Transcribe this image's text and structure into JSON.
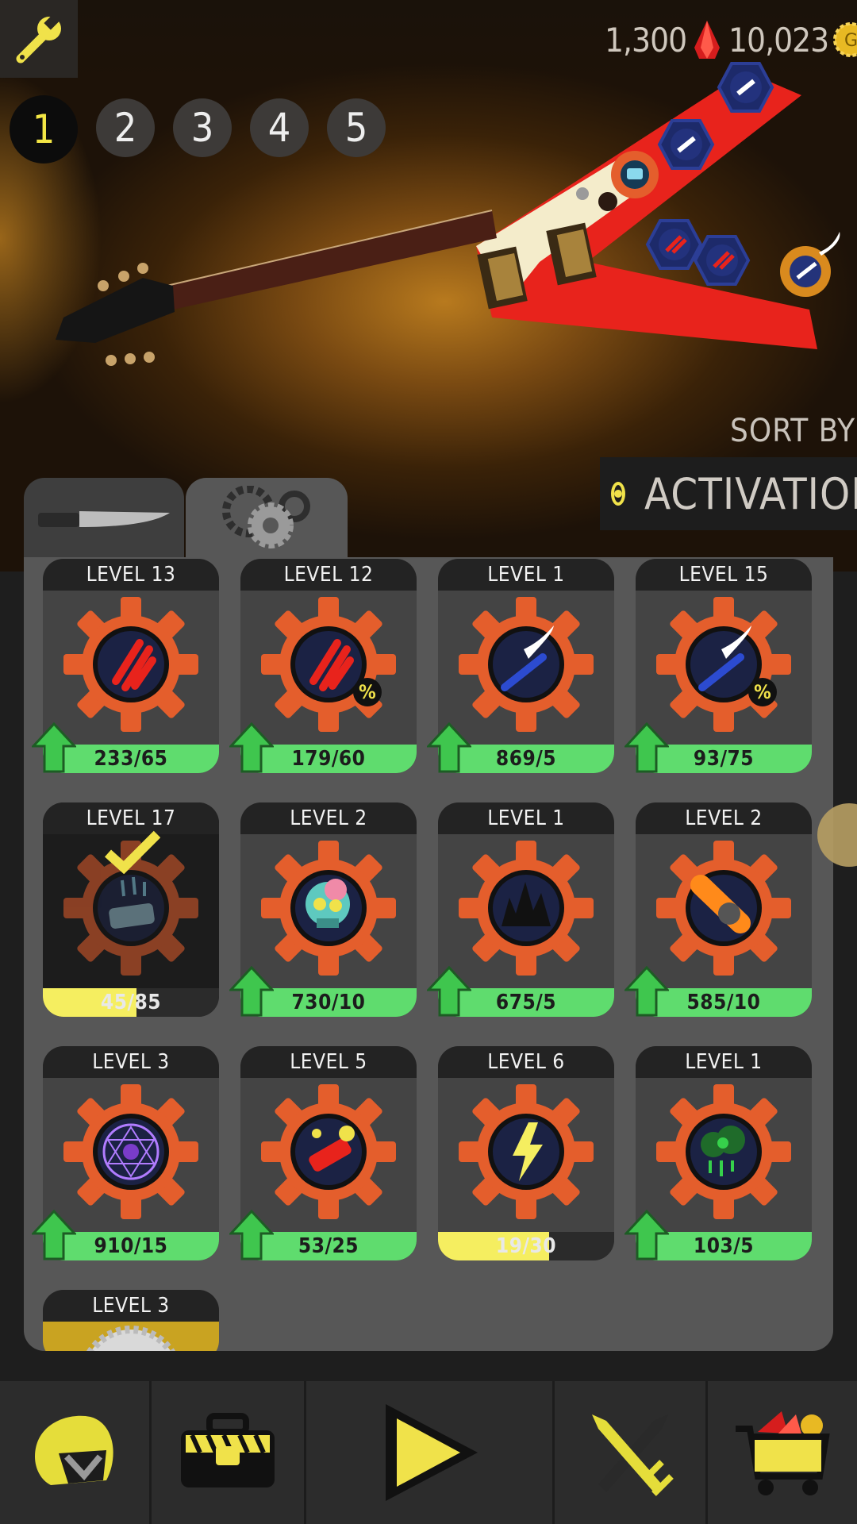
{
  "currency": {
    "gems": "1,300",
    "gold": "10,023",
    "gold_symbol": "G"
  },
  "loadouts": [
    "1",
    "2",
    "3",
    "4",
    "5"
  ],
  "active_loadout": "1",
  "sort": {
    "label": "SORT BY",
    "value": "ACTIVATION"
  },
  "tabs": [
    {
      "name": "knife-tab-icon"
    },
    {
      "name": "gears-tab-icon"
    }
  ],
  "active_tab": 1,
  "cards": [
    {
      "level": "LEVEL 13",
      "progress": "233/65",
      "fill": 1.0,
      "bar": "green",
      "upgrade": true,
      "icon": "red-claw-icon",
      "percent": false
    },
    {
      "level": "LEVEL 12",
      "progress": "179/60",
      "fill": 1.0,
      "bar": "green",
      "upgrade": true,
      "icon": "red-claw-icon",
      "percent": true
    },
    {
      "level": "LEVEL 1",
      "progress": "869/5",
      "fill": 1.0,
      "bar": "green",
      "upgrade": true,
      "icon": "winged-sword-icon",
      "percent": false
    },
    {
      "level": "LEVEL 15",
      "progress": "93/75",
      "fill": 1.0,
      "bar": "green",
      "upgrade": true,
      "icon": "winged-sword-icon",
      "percent": true
    },
    {
      "level": "LEVEL 17",
      "progress": "45/85",
      "fill": 0.53,
      "bar": "yellow",
      "upgrade": false,
      "icon": "ice-shard-icon",
      "percent": false,
      "selected": true
    },
    {
      "level": "LEVEL 2",
      "progress": "730/10",
      "fill": 1.0,
      "bar": "green",
      "upgrade": true,
      "icon": "zombie-skull-icon",
      "percent": false
    },
    {
      "level": "LEVEL 1",
      "progress": "675/5",
      "fill": 1.0,
      "bar": "green",
      "upgrade": true,
      "icon": "ground-spikes-icon",
      "percent": false
    },
    {
      "level": "LEVEL 2",
      "progress": "585/10",
      "fill": 1.0,
      "bar": "green",
      "upgrade": true,
      "icon": "meteor-icon",
      "percent": false
    },
    {
      "level": "LEVEL 3",
      "progress": "910/15",
      "fill": 1.0,
      "bar": "green",
      "upgrade": true,
      "icon": "magic-circle-icon",
      "percent": false
    },
    {
      "level": "LEVEL 5",
      "progress": "53/25",
      "fill": 1.0,
      "bar": "green",
      "upgrade": true,
      "icon": "firecracker-icon",
      "percent": false
    },
    {
      "level": "LEVEL 6",
      "progress": "19/30",
      "fill": 0.63,
      "bar": "yellow",
      "upgrade": false,
      "icon": "lightning-icon",
      "percent": false
    },
    {
      "level": "LEVEL 1",
      "progress": "103/5",
      "fill": 1.0,
      "bar": "green",
      "upgrade": true,
      "icon": "toxic-cloud-icon",
      "percent": false
    },
    {
      "level": "LEVEL 3",
      "progress": "",
      "fill": 0,
      "bar": "none",
      "upgrade": false,
      "icon": "saw-blade-icon",
      "percent": false,
      "partial": true
    }
  ],
  "nav": [
    {
      "name": "helmet-icon"
    },
    {
      "name": "toolbox-icon"
    },
    {
      "name": "play-icon"
    },
    {
      "name": "crossed-swords-icon"
    },
    {
      "name": "shop-cart-icon"
    }
  ],
  "colors": {
    "accent_yellow": "#f0e24a",
    "bar_green": "#5fdc6e",
    "bar_yellow": "#f5ee60",
    "gear_orange": "#e45e2c",
    "guitar_red": "#e8231c"
  }
}
